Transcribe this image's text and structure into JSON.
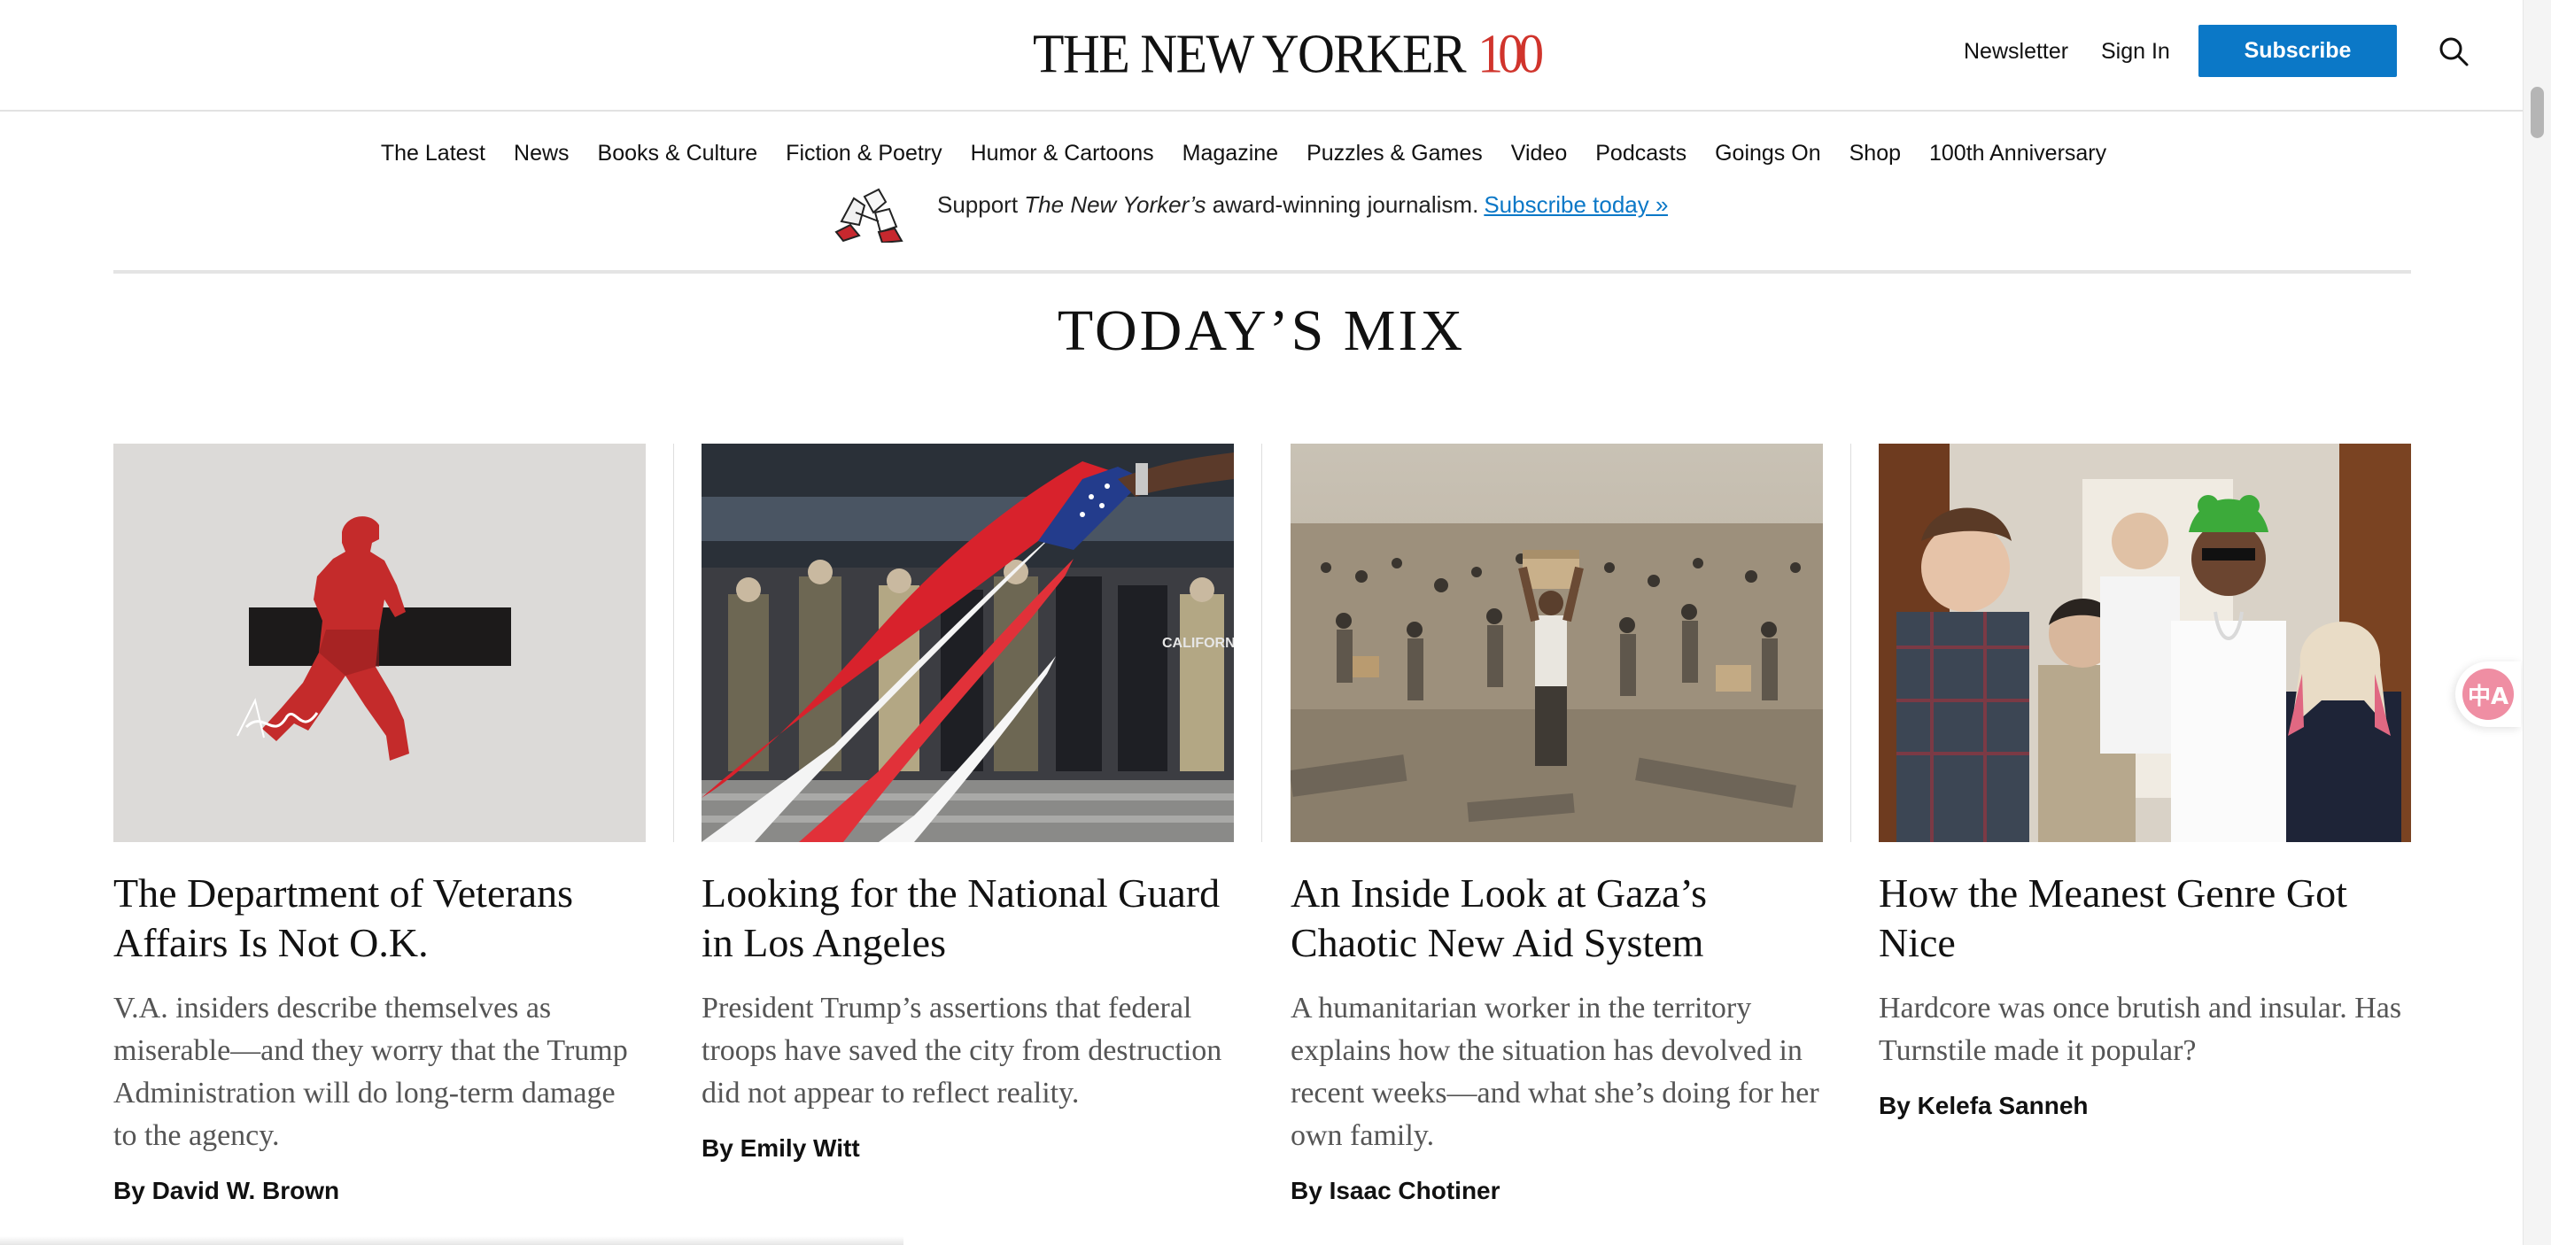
{
  "header": {
    "logo_text": "THE NEW YORKER",
    "logo_anniversary": "100",
    "newsletter": "Newsletter",
    "sign_in": "Sign In",
    "subscribe": "Subscribe",
    "search_icon": "search-icon",
    "accent_color": "#0b78c7",
    "logo_accent_color": "#d0342c"
  },
  "nav": {
    "items": [
      "The Latest",
      "News",
      "Books & Culture",
      "Fiction & Poetry",
      "Humor & Cartoons",
      "Magazine",
      "Puzzles & Games",
      "Video",
      "Podcasts",
      "Goings On",
      "Shop",
      "100th Anniversary"
    ]
  },
  "promo": {
    "text_before": "Support ",
    "publication": "The New Yorker’s",
    "text_after": " award-winning journalism.",
    "link": "Subscribe today »"
  },
  "section": {
    "title": "TODAY’S MIX"
  },
  "cards": [
    {
      "title": "The Department of Veterans Affairs Is Not O.K.",
      "dek": "V.A. insiders describe themselves as miserable—and they worry that the Trump Administration will do long-term damage to the agency.",
      "byline": "By David W. Brown"
    },
    {
      "title": "Looking for the National Guard in Los Angeles",
      "dek": "President Trump’s assertions that federal troops have saved the city from destruction did not appear to reflect reality.",
      "byline": "By Emily Witt"
    },
    {
      "title": "An Inside Look at Gaza’s Chaotic New Aid System",
      "dek": "A humanitarian worker in the territory explains how the situation has devolved in recent weeks—and what she’s doing for her own family.",
      "byline": "By Isaac Chotiner"
    },
    {
      "title": "How the Meanest Genre Got Nice",
      "dek": "Hardcore was once brutish and insular. Has Turnstile made it popular?",
      "byline": "By Kelefa Sanneh"
    }
  ],
  "floating": {
    "translate_icon": "translate-icon",
    "glyph": "中A"
  }
}
